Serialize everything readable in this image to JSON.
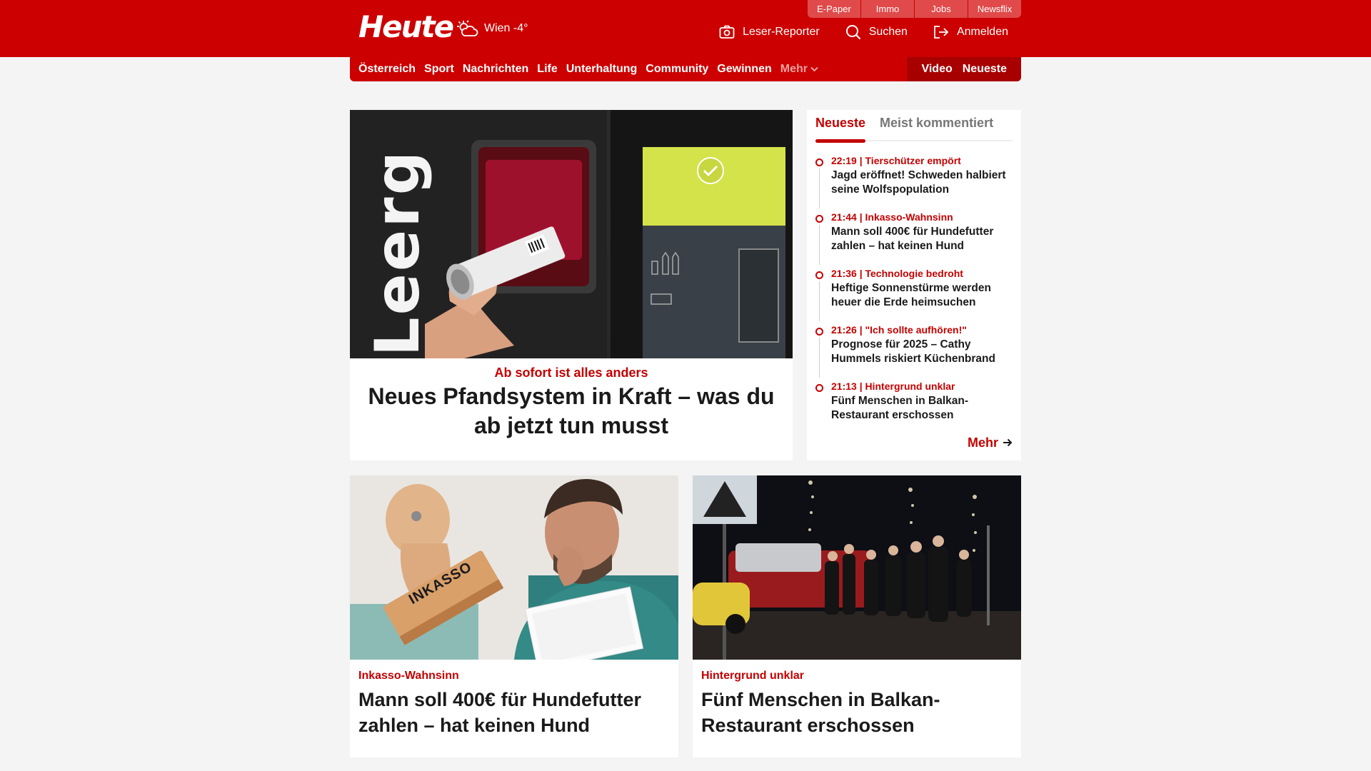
{
  "header": {
    "logo": "Heute",
    "weather": "Wien -4°",
    "util_tabs": [
      "E-Paper",
      "Immo",
      "Jobs",
      "Newsflix"
    ],
    "links": {
      "reporter": "Leser-Reporter",
      "search": "Suchen",
      "login": "Anmelden"
    }
  },
  "nav": {
    "items": [
      "Österreich",
      "Sport",
      "Nachrichten",
      "Life",
      "Unterhaltung",
      "Community",
      "Gewinnen"
    ],
    "more": "Mehr",
    "right": [
      "Video",
      "Neueste"
    ]
  },
  "hero": {
    "kicker": "Ab sofort ist alles anders",
    "title": "Neues Pfandsystem in Kraft – was du ab jetzt tun musst",
    "image_text": "Leerg"
  },
  "sidebar": {
    "tabs": [
      "Neueste",
      "Meist kommentiert"
    ],
    "items": [
      {
        "meta": "22:19 | Tierschützer empört",
        "title": "Jagd eröffnet! Schweden halbiert seine Wolfspopulation"
      },
      {
        "meta": "21:44 | Inkasso-Wahnsinn",
        "title": "Mann soll 400€ für Hundefutter zahlen – hat keinen Hund"
      },
      {
        "meta": "21:36 | Technologie bedroht",
        "title": "Heftige Sonnenstürme werden heuer die Erde heimsuchen"
      },
      {
        "meta": "21:26 | \"Ich sollte aufhören!\"",
        "title": "Prognose für 2025 – Cathy Hummels riskiert Küchenbrand"
      },
      {
        "meta": "21:13 | Hintergrund unklar",
        "title": "Fünf Menschen in Balkan-Restaurant erschossen"
      }
    ],
    "more": "Mehr"
  },
  "cards": [
    {
      "kicker": "Inkasso-Wahnsinn",
      "title": "Mann soll 400€ für Hundefutter zahlen – hat keinen Hund",
      "stamp": "INKASSO"
    },
    {
      "kicker": "Hintergrund unklar",
      "title": "Fünf Menschen in Balkan-Restaurant erschossen"
    }
  ],
  "colors": {
    "brand": "#cc0000",
    "brand_dark": "#a80000",
    "accent_text": "#c40000"
  }
}
